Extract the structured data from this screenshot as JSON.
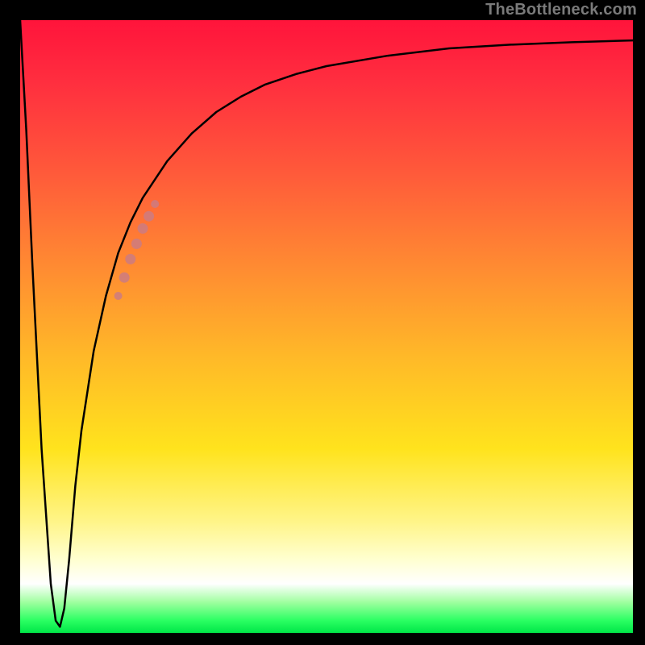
{
  "watermark": "TheBottleneck.com",
  "chart_data": {
    "type": "line",
    "title": "",
    "xlabel": "",
    "ylabel": "",
    "xlim": [
      0,
      100
    ],
    "ylim": [
      0,
      100
    ],
    "grid": false,
    "legend": false,
    "background_gradient": {
      "orientation": "vertical",
      "stops": [
        {
          "pos": 0,
          "color": "#ff143b"
        },
        {
          "pos": 25,
          "color": "#ff5a3a"
        },
        {
          "pos": 55,
          "color": "#ffb928"
        },
        {
          "pos": 82,
          "color": "#fff58a"
        },
        {
          "pos": 92,
          "color": "#ffffff"
        },
        {
          "pos": 100,
          "color": "#00e648"
        }
      ]
    },
    "series": [
      {
        "name": "bottleneck-curve",
        "color": "#000000",
        "x": [
          0.0,
          1.0,
          2.0,
          3.5,
          5.0,
          5.8,
          6.5,
          7.2,
          8.0,
          9.0,
          10.0,
          12.0,
          14.0,
          16.0,
          18.0,
          20.0,
          24.0,
          28.0,
          32.0,
          36.0,
          40.0,
          45.0,
          50.0,
          60.0,
          70.0,
          80.0,
          90.0,
          100.0
        ],
        "y": [
          100.0,
          82.0,
          60.0,
          30.0,
          8.0,
          2.0,
          1.0,
          4.0,
          12.0,
          24.0,
          33.0,
          46.0,
          55.0,
          62.0,
          67.0,
          71.0,
          77.0,
          81.5,
          85.0,
          87.5,
          89.5,
          91.2,
          92.5,
          94.2,
          95.4,
          96.0,
          96.4,
          96.7
        ]
      }
    ],
    "highlight_points": {
      "name": "highlight-segment",
      "color": "#cc7b81",
      "x": [
        16.0,
        17.0,
        18.0,
        19.0,
        20.0,
        21.0,
        22.0
      ],
      "y": [
        55.0,
        58.0,
        61.0,
        63.5,
        66.0,
        68.0,
        70.0
      ]
    }
  }
}
